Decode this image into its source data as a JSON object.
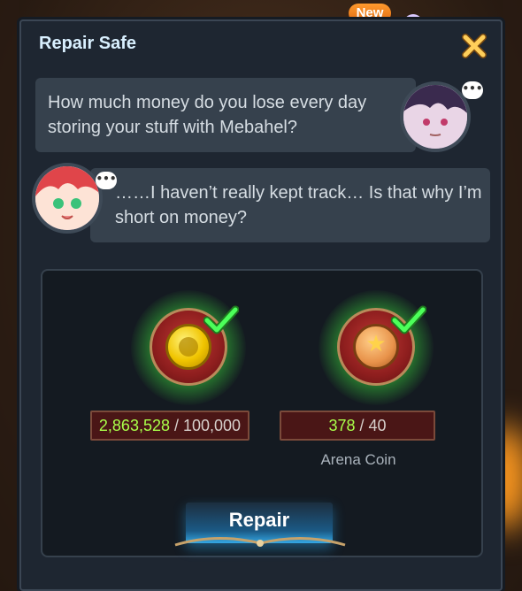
{
  "header": {
    "new_badge": "New"
  },
  "dialog": {
    "title": "Repair Safe",
    "close_icon": "close-x-icon"
  },
  "conversation": [
    {
      "speaker_side": "right",
      "text": "How much money do you lose every day storing your stuff with Mebahel?"
    },
    {
      "speaker_side": "left",
      "text": "……I haven’t really kept track… Is that why I’m short on money?"
    }
  ],
  "requirements": [
    {
      "icon": "gold-coin-icon",
      "owned": "2,863,528",
      "required": "/ 100,000",
      "label": "",
      "satisfied": true
    },
    {
      "icon": "arena-coin-icon",
      "owned": "378",
      "required": "/ 40",
      "label": "Arena Coin",
      "satisfied": true
    }
  ],
  "actions": {
    "repair_label": "Repair"
  },
  "colors": {
    "panel_bg": "#1e2631",
    "bubble_bg": "#36414d",
    "owned_value": "#a9ff4a",
    "check_green": "#4cff5a",
    "accent_gold": "#f0c400",
    "button_blue": "#1b5a86"
  }
}
